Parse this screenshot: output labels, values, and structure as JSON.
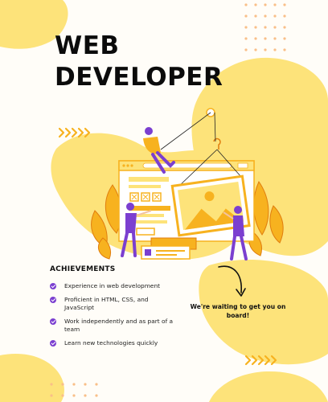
{
  "title_lines": [
    "WEB",
    "DEVELOPER"
  ],
  "achievements": {
    "heading": "ACHIEVEMENTS",
    "items": [
      "Experience in web development",
      "Proficient in HTML, CSS, and JavaScript",
      "Work independently and as part of a team",
      "Learn new technologies quickly"
    ]
  },
  "call_to_action": "We're waiting to get you on board!",
  "colors": {
    "accent_yellow": "#fde37a",
    "deep_yellow": "#f7b21f",
    "purple": "#7b3fd0",
    "text": "#0b0b0b"
  },
  "icons": [
    "chevrons-right-icon",
    "check-circle-icon",
    "curved-arrow-icon",
    "dot-grid-icon"
  ]
}
